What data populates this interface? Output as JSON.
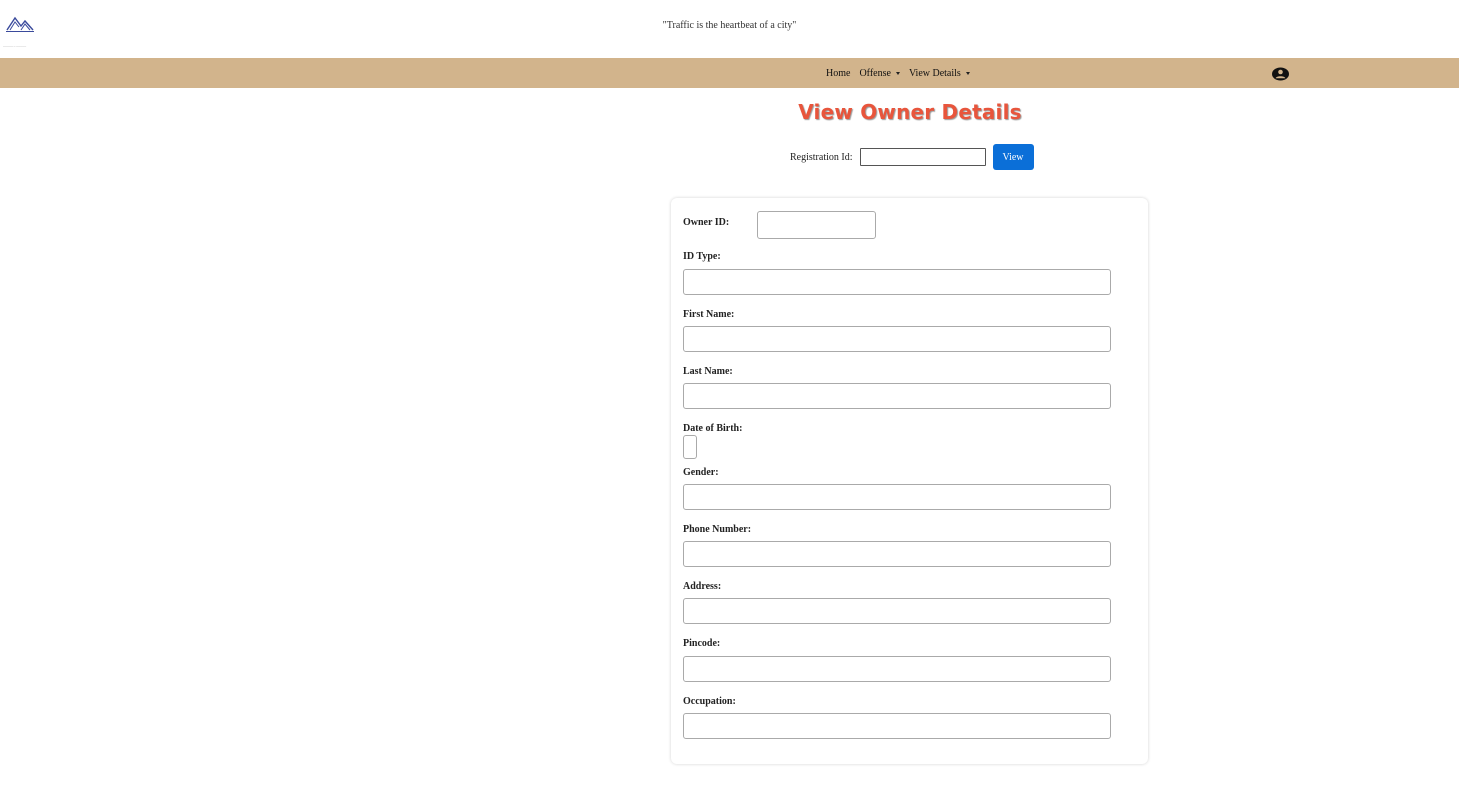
{
  "header": {
    "logo_tagline": "————— — —————",
    "tagline": "\"Traffic is the heartbeat of a city\""
  },
  "nav": {
    "home": "Home",
    "offense": "Offense",
    "view_details": "View Details",
    "user_icon": "user-circle-icon",
    "bg_color": "#d2b48c"
  },
  "main": {
    "title": "View Owner Details",
    "title_color": "#e8553c",
    "search": {
      "label": "Registration Id:",
      "value": "",
      "button": "View",
      "button_color": "#0b6fd8"
    }
  },
  "form": {
    "owner_id": {
      "label": "Owner ID:",
      "value": ""
    },
    "id_type": {
      "label": "ID Type:",
      "value": ""
    },
    "first_name": {
      "label": "First Name:",
      "value": ""
    },
    "last_name": {
      "label": "Last Name:",
      "value": ""
    },
    "dob": {
      "label": "Date of Birth:",
      "value": ""
    },
    "gender": {
      "label": "Gender:",
      "value": ""
    },
    "phone": {
      "label": "Phone Number:",
      "value": ""
    },
    "address": {
      "label": "Address:",
      "value": ""
    },
    "pincode": {
      "label": "Pincode:",
      "value": ""
    },
    "occupation": {
      "label": "Occupation:",
      "value": ""
    }
  }
}
